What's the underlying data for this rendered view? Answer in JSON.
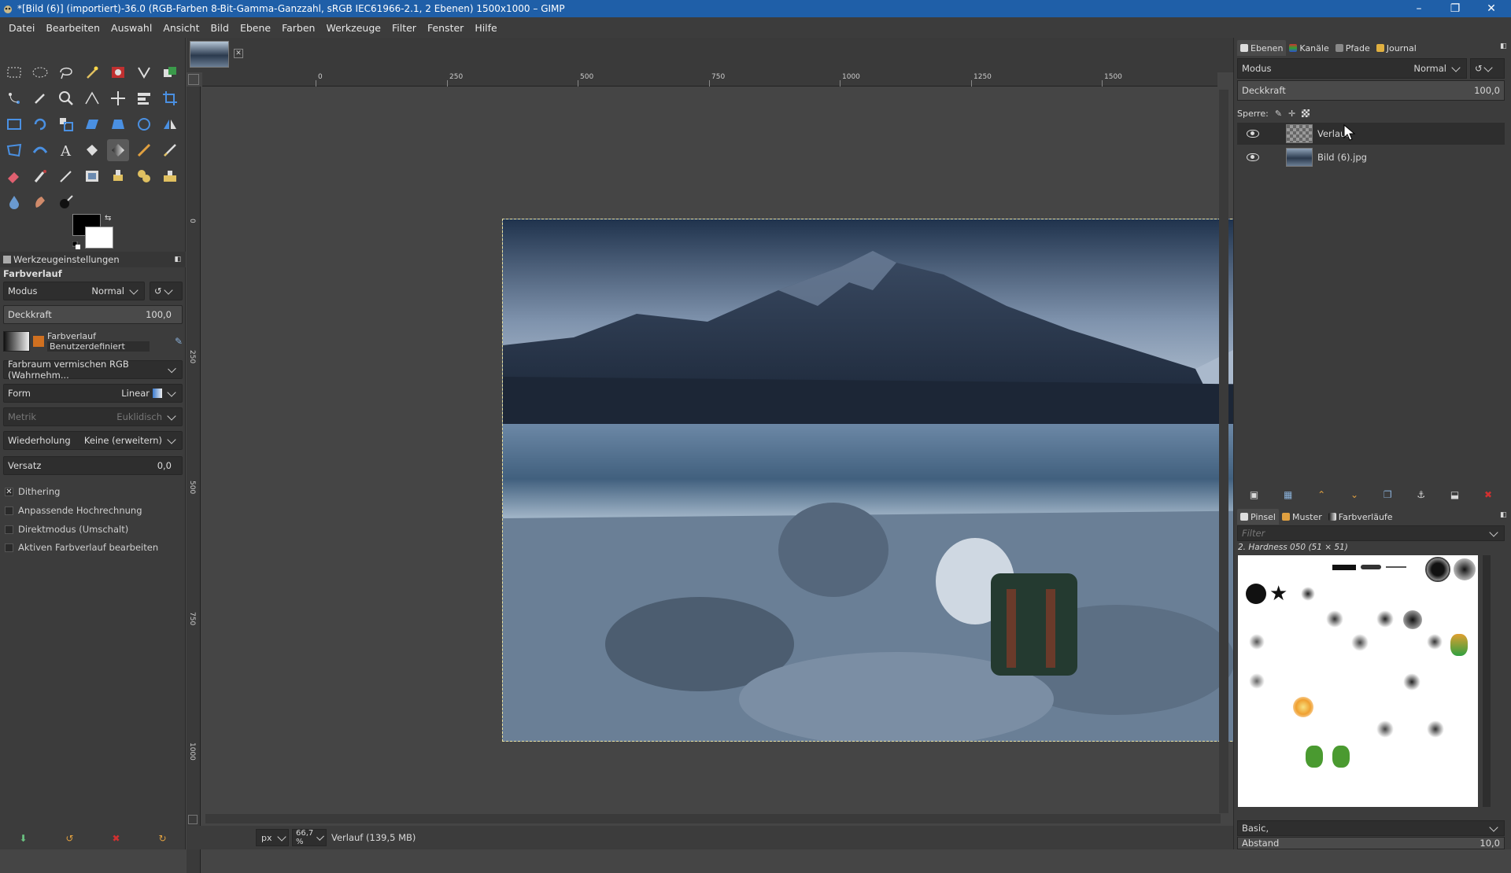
{
  "window": {
    "title": "*[Bild (6)] (importiert)-36.0 (RGB-Farben 8-Bit-Gamma-Ganzzahl, sRGB IEC61966-2.1, 2 Ebenen) 1500x1000 – GIMP"
  },
  "menu": [
    "Datei",
    "Bearbeiten",
    "Auswahl",
    "Ansicht",
    "Bild",
    "Ebene",
    "Farben",
    "Werkzeuge",
    "Filter",
    "Fenster",
    "Hilfe"
  ],
  "tool_options": {
    "panel_title": "Werkzeugeinstellungen",
    "tool_name": "Farbverlauf",
    "mode_label": "Modus",
    "mode_value": "Normal",
    "opacity_label": "Deckkraft",
    "opacity_value": "100,0",
    "gradient_label": "Farbverlauf",
    "gradient_name": "Benutzerdefiniert",
    "blend_space": "Farbraum vermischen RGB (Wahrnehm...",
    "shape_label": "Form",
    "shape_value": "Linear",
    "metric_label": "Metrik",
    "metric_value": "Euklidisch",
    "repeat_label": "Wiederholung",
    "repeat_value": "Keine (erweitern)",
    "offset_label": "Versatz",
    "offset_value": "0,0",
    "dithering": "Dithering",
    "adaptive": "Anpassende Hochrechnung",
    "instant": "Direktmodus (Umschalt)",
    "edit_active": "Aktiven Farbverlauf bearbeiten"
  },
  "ruler": {
    "h": [
      "0",
      "250",
      "500",
      "750",
      "1000",
      "1250",
      "1500"
    ],
    "v": [
      "0",
      "250",
      "500",
      "750",
      "1000"
    ]
  },
  "status": {
    "unit": "px",
    "zoom": "66,7 %",
    "text": "Verlauf (139,5 MB)"
  },
  "layers_dock": {
    "tabs": [
      "Ebenen",
      "Kanäle",
      "Pfade",
      "Journal"
    ],
    "mode_label": "Modus",
    "mode_value": "Normal",
    "opacity_label": "Deckkraft",
    "opacity_value": "100,0",
    "lock_label": "Sperre:",
    "layers": [
      {
        "name": "Verlauf"
      },
      {
        "name": "Bild (6).jpg"
      }
    ]
  },
  "brushes_dock": {
    "tabs": [
      "Pinsel",
      "Muster",
      "Farbverläufe"
    ],
    "filter_placeholder": "Filter",
    "brush_name": "2. Hardness 050 (51 × 51)",
    "tag": "Basic,",
    "spacing_label": "Abstand",
    "spacing_value": "10,0"
  }
}
